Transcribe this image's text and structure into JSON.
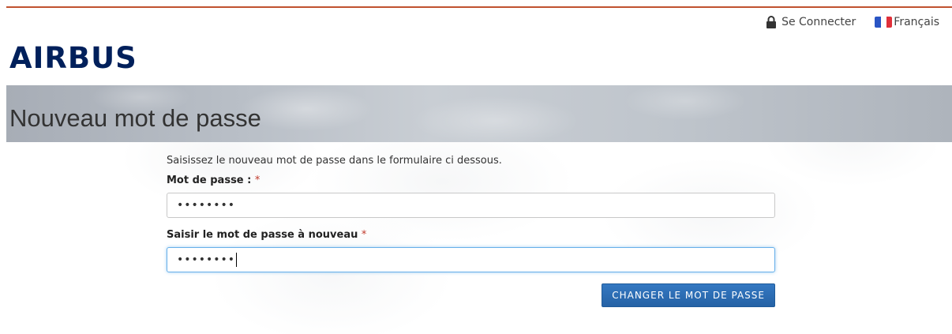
{
  "header": {
    "login_label": "Se Connecter",
    "language_label": "Français",
    "lock_icon": "lock-icon",
    "flag_icon": "french-flag-icon",
    "flag_colors": [
      "#2a55c4",
      "#ffffff",
      "#e0303a"
    ]
  },
  "brand": {
    "logo_text": "AIRBUS",
    "logo_color": "#00205b"
  },
  "page": {
    "title": "Nouveau mot de passe"
  },
  "form": {
    "intro": "Saisissez le nouveau mot de passe dans le formulaire ci dessous.",
    "password_label": "Mot de passe :",
    "password_value": "••••••••",
    "confirm_label": "Saisir le mot de passe à nouveau",
    "confirm_value": "••••••••",
    "required_mark": "*",
    "submit_label": "CHANGER LE MOT DE PASSE"
  },
  "colors": {
    "accent_line": "#c0522f",
    "button": "#2b6cb0",
    "required": "#c0392b"
  }
}
